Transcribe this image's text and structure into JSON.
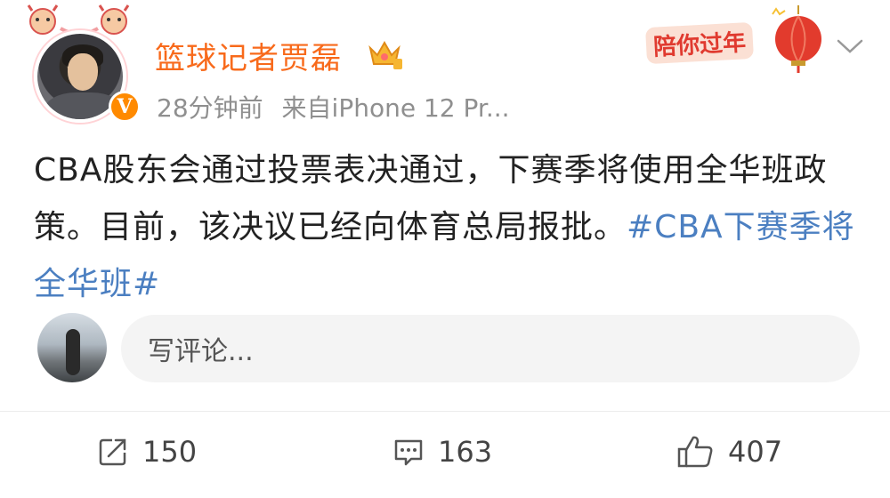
{
  "author": {
    "name": "篮球记者贾磊",
    "verified_mark": "V"
  },
  "meta": {
    "time": "28分钟前",
    "source": "来自iPhone 12 Pr..."
  },
  "festive_badge": "陪你过年",
  "post": {
    "text": "CBA股东会通过投票表决通过，下赛季将使用全华班政策。目前，该决议已经向体育总局报批。",
    "hashtag": "#CBA下赛季将全华班#"
  },
  "comment_box": {
    "placeholder": "写评论..."
  },
  "actions": {
    "share_count": "150",
    "comment_count": "163",
    "like_count": "407"
  },
  "colors": {
    "username": "#f86a1b",
    "hashtag": "#4b7fc1",
    "meta": "#8f8f8f"
  }
}
